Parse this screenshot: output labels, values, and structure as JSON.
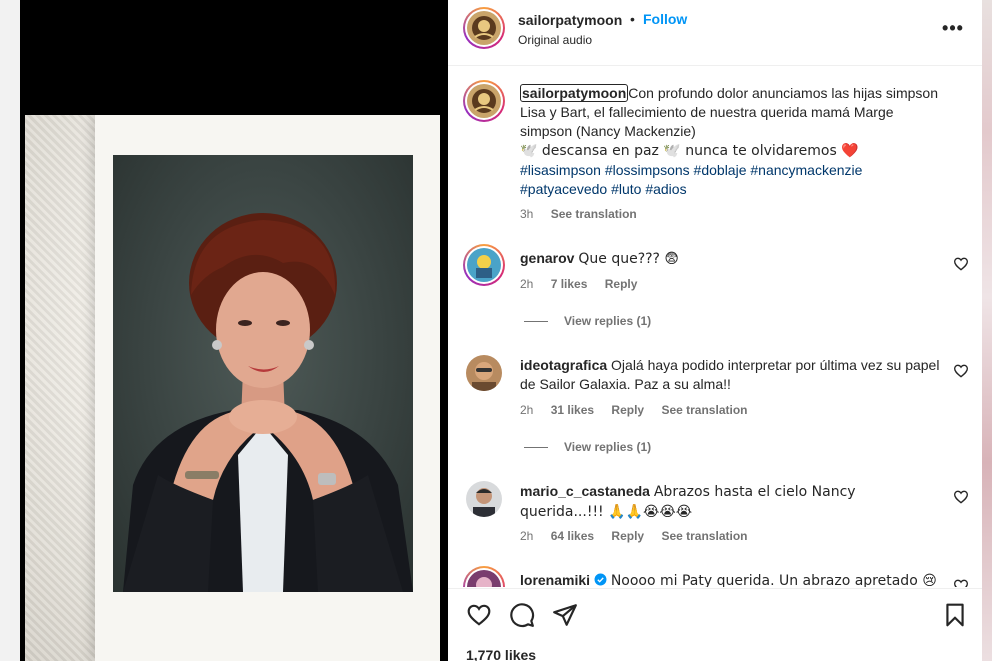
{
  "post": {
    "username": "sailorpatymoon",
    "separator": "•",
    "follow_label": "Follow",
    "audio_label": "Original audio",
    "more_label": "•••"
  },
  "caption": {
    "username": "sailorpatymoon",
    "text_main": "Con profundo dolor anunciamos las hijas simpson Lisa y Bart, el fallecimiento de nuestra querida mamá Marge simpson (Nancy Mackenzie)",
    "text_second": "🕊️ descansa en paz 🕊️ nunca te olvidaremos ❤️",
    "hashtags": [
      "#lisasimpson",
      "#lossimpsons",
      "#doblaje",
      "#nancymackenzie",
      "#patyacevedo",
      "#luto",
      "#adios"
    ],
    "time": "3h",
    "see_translation": "See translation"
  },
  "comments": [
    {
      "username": "genarov",
      "text": "Que que??? 😨",
      "time": "2h",
      "likes": "7 likes",
      "reply": "Reply",
      "see_translation": "",
      "view_replies": "View replies (1)"
    },
    {
      "username": "ideotagrafica",
      "text": "Ojalá haya podido interpretar por última vez su papel de Sailor Galaxia. Paz a su alma!!",
      "time": "2h",
      "likes": "31 likes",
      "reply": "Reply",
      "see_translation": "See translation",
      "view_replies": "View replies (1)"
    },
    {
      "username": "mario_c_castaneda",
      "text": "Abrazos hasta el cielo Nancy querida...!!! 🙏🙏😭😭😭",
      "time": "2h",
      "likes": "64 likes",
      "reply": "Reply",
      "see_translation": "See translation",
      "view_replies": ""
    },
    {
      "username": "lorenamiki",
      "text": "Noooo mi Paty querida. Un abrazo apretado 😢",
      "verified": true
    }
  ],
  "footer": {
    "likes": "1,770 likes"
  },
  "colors": {
    "follow": "#0095f6",
    "hashtag": "#00376b",
    "meta": "#737373",
    "heart_emoji": "#e0245e",
    "verified": "#0095f6"
  },
  "icons": {
    "more": "more-horizontal-icon",
    "heart": "heart-outline-icon",
    "comment": "comment-icon",
    "share": "share-icon",
    "save": "bookmark-icon",
    "verified": "verified-badge-icon"
  }
}
